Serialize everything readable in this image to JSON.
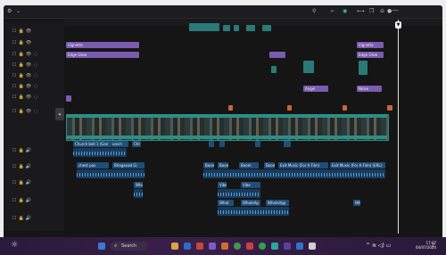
{
  "app": {
    "title": ""
  },
  "timeline": {
    "effects": {
      "vignette_left": "Vignette",
      "edge_glow_left": "Edge Glow",
      "vignette_right": "Vignette",
      "edge_glow_right": "Edge Glow",
      "angel": "Angel",
      "noise": "Noise"
    },
    "audio_clips": {
      "church_bell": "Church bell 1 (Gan",
      "unich": "unich",
      "chr": "Chr",
      "chest_pos": "chest pos",
      "bhagavad_gita": "Bhagavad Gi",
      "boom1": "Boom",
      "boom2": "Boom",
      "boom3": "Boom",
      "boom4": "Boom",
      "exit_music_1": "Exit Music (For A Film)",
      "exit_music_2": "Exit Music (For A Film) (ERL)",
      "whoosh1": "Whoo",
      "vibe": "Vibe",
      "vibe2": "Vibe",
      "whatsapp1": "WhatsAp",
      "whatsapp2": "WhatsApp",
      "whatsapp3": "WhatsAp",
      "what": "What"
    }
  },
  "taskbar": {
    "search_label": "Search",
    "time": "17:07",
    "date": "04/07/2024"
  }
}
